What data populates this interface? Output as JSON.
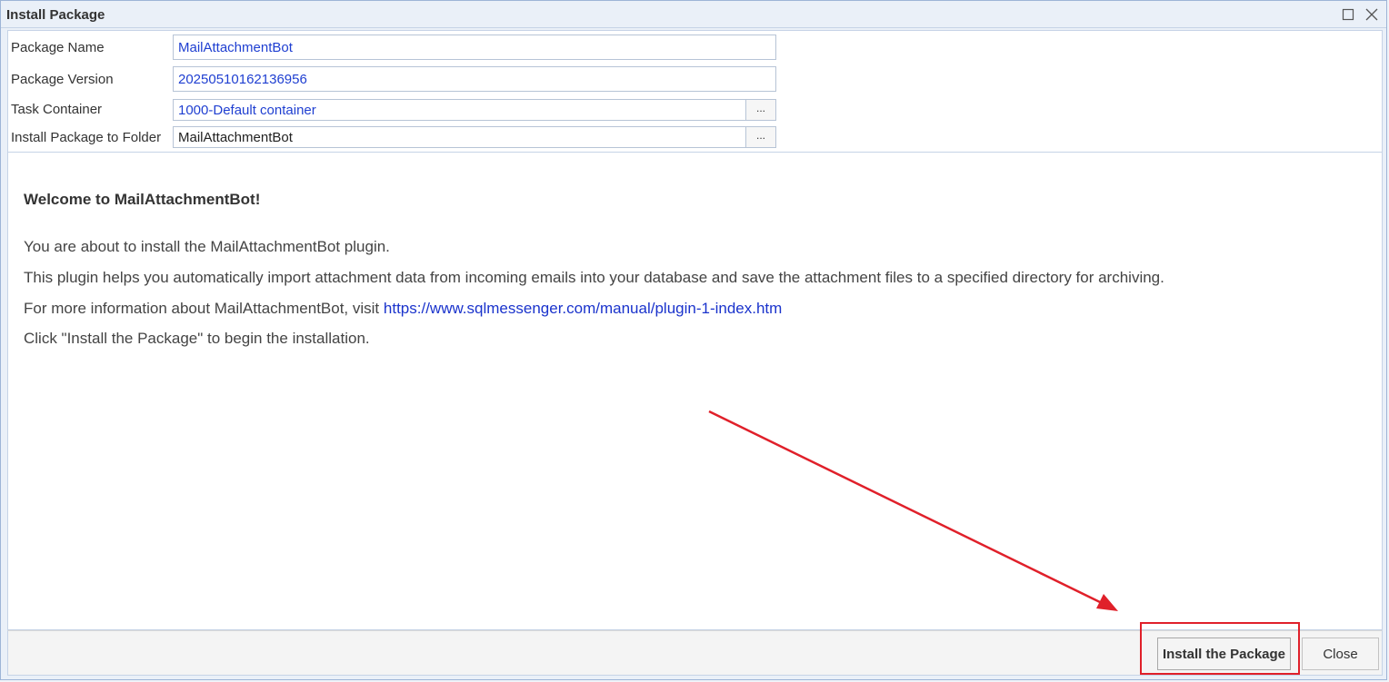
{
  "window": {
    "title": "Install Package"
  },
  "form": {
    "package_name": {
      "label": "Package Name",
      "value": "MailAttachmentBot"
    },
    "package_version": {
      "label": "Package Version",
      "value": "20250510162136956"
    },
    "task_container": {
      "label": "Task Container",
      "value": "1000-Default container",
      "browse_label": "..."
    },
    "install_folder": {
      "label": "Install Package to Folder",
      "value": "MailAttachmentBot",
      "browse_label": "..."
    }
  },
  "content": {
    "heading": "Welcome to MailAttachmentBot!",
    "line1": "You are about to install the MailAttachmentBot plugin.",
    "line2": "This plugin helps you automatically import attachment data from incoming emails into your database and save the attachment files to a specified directory for archiving.",
    "line3_prefix": "For more information about MailAttachmentBot, visit ",
    "line3_link": "https://www.sqlmessenger.com/manual/plugin-1-index.htm",
    "line4": "Click \"Install the Package\" to begin the installation."
  },
  "footer": {
    "install_label": "Install the Package",
    "close_label": "Close"
  },
  "annotation": {
    "color": "#e0202a"
  }
}
